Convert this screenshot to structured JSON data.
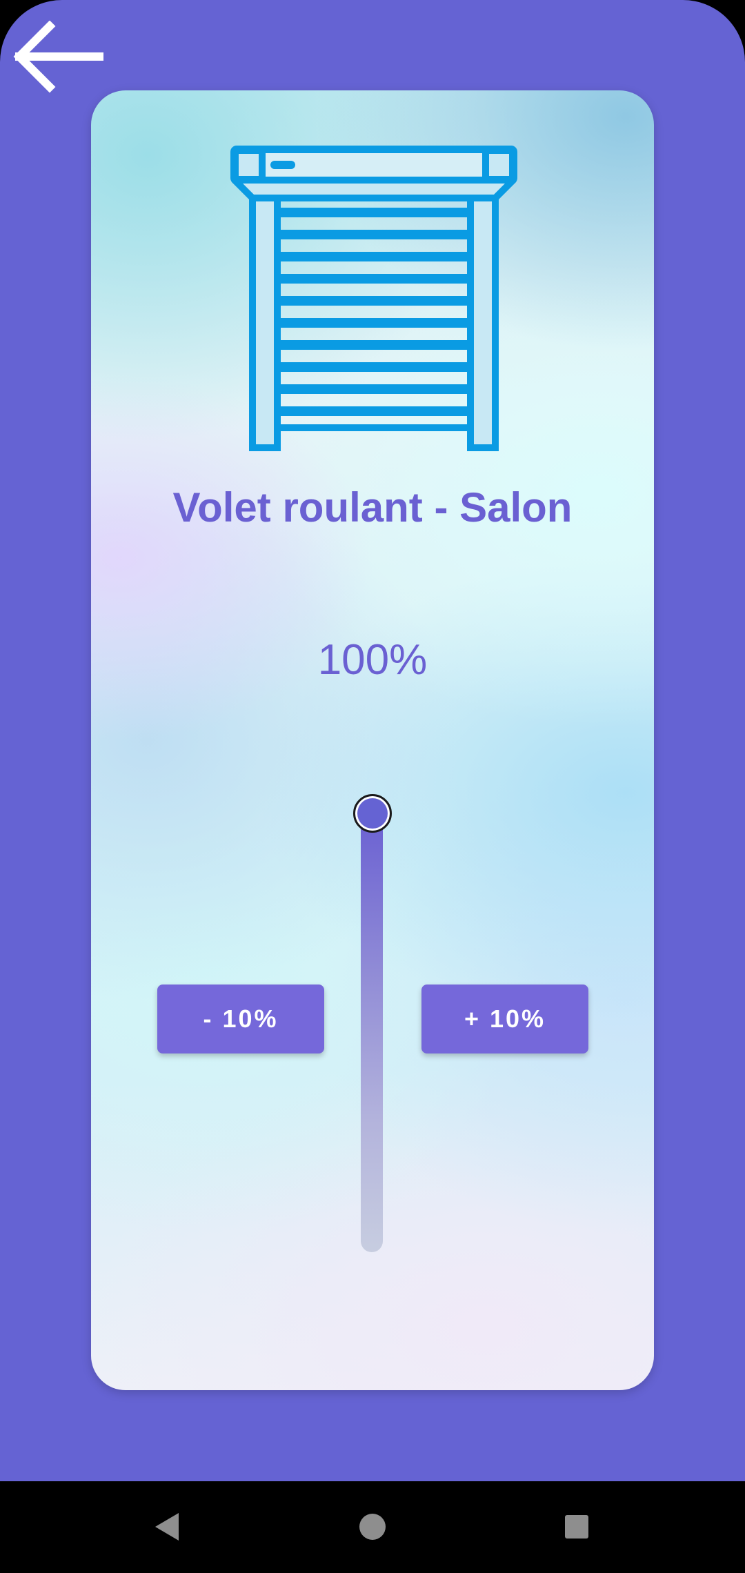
{
  "header": {
    "back_icon": "arrow-left-icon"
  },
  "device": {
    "title": "Volet roulant - Salon",
    "icon": "roller-shutter-icon",
    "icon_color": "#0a9be3",
    "position_label": "100%",
    "position_value": 1.0
  },
  "controls": {
    "minus_label": "- 10%",
    "plus_label": "+ 10%",
    "slider_icon": "vertical-slider"
  },
  "colors": {
    "background": "#6563d3",
    "accent": "#6a60d2",
    "button": "#7568da"
  },
  "navigation_bar": {
    "back_icon": "triangle-back-icon",
    "home_icon": "circle-home-icon",
    "recents_icon": "square-recents-icon"
  }
}
